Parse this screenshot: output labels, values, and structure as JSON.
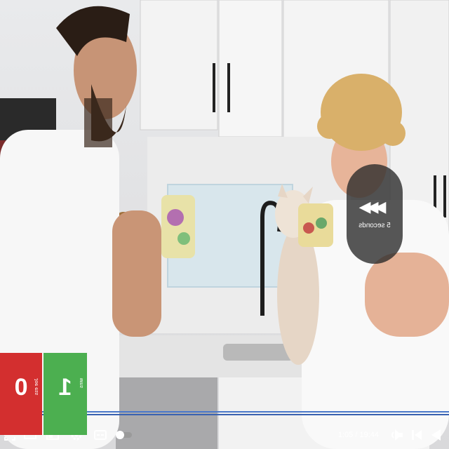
{
  "seek_overlay": {
    "label": "5 seconds"
  },
  "scoreboard": {
    "left_score": "0",
    "left_label": "Joe ess",
    "right_score": "1",
    "right_label": "wins"
  },
  "player": {
    "current_time": "1:05",
    "duration": "19:44",
    "progress_fraction": 0.055,
    "icons": [
      "play-icon",
      "skip-next-icon",
      "volume-icon",
      "autoplay-toggle-icon",
      "captions-icon",
      "settings-icon",
      "miniplayer-icon",
      "theater-icon",
      "fullscreen-icon"
    ]
  }
}
